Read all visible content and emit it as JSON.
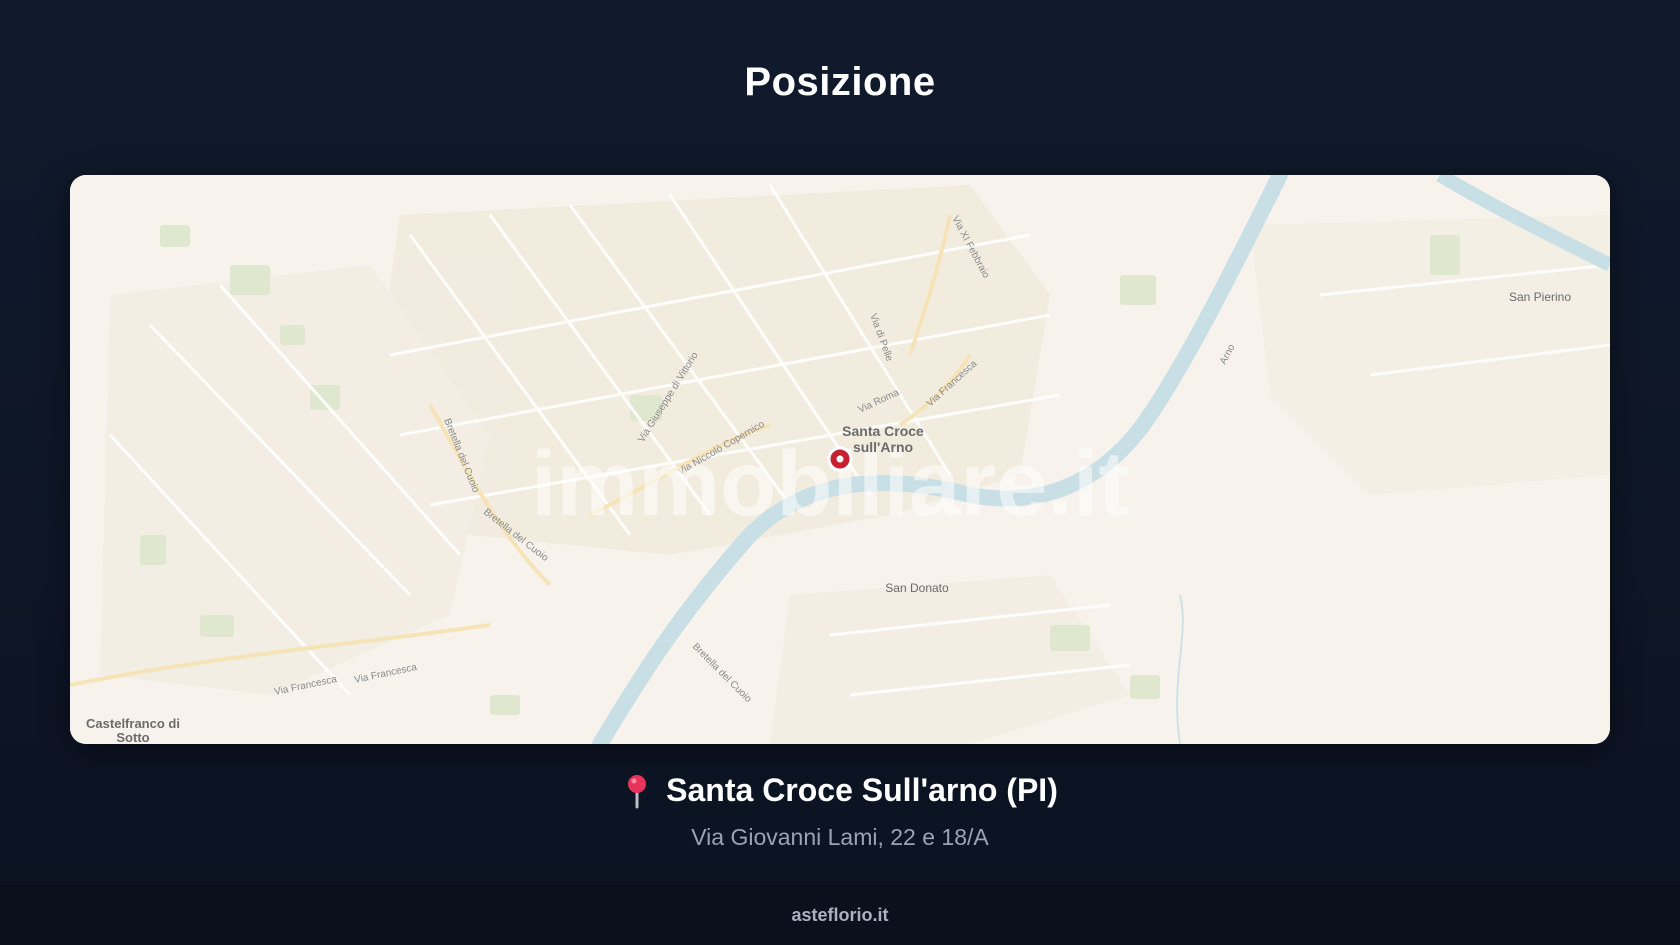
{
  "page": {
    "title": "Posizione"
  },
  "map": {
    "watermark": "immobiliare.it",
    "places": {
      "center_line1": "Santa Croce",
      "center_line2": "sull'Arno",
      "san_donato": "San Donato",
      "san_pierino": "San Pierino",
      "castelfranco_line1": "Castelfranco di",
      "castelfranco_line2": "Sotto"
    },
    "streets": {
      "via_giuseppe_di_vittorio": "Via Giuseppe di Vittorio",
      "via_copernico": "Via Niccolò Copernico",
      "via_roma": "Via Roma",
      "via_francesca_1": "Via Francesca",
      "via_francesca_2": "Via Francesca",
      "via_francesca_3": "Via Francesca",
      "bretella_cuoio_1": "Bretella del Cuoio",
      "bretella_cuoio_2": "Bretella del Cuoio",
      "bretella_cuoio_3": "Bretella del Cuoio",
      "via_xi_febbraio": "Via XI Febbraio",
      "via_di_pelle": "Via di Pelle",
      "arno": "Arno"
    },
    "colors": {
      "land": "#f7f3ec",
      "river": "#c9dfe6",
      "park": "#dfe8cf",
      "marker": "#c8202f"
    }
  },
  "location": {
    "city": "Santa Croce Sull'arno (PI)",
    "address": "Via Giovanni Lami, 22 e 18/A",
    "pin_icon": "map-pin-icon"
  },
  "footer": {
    "brand": "asteflorio.it"
  }
}
